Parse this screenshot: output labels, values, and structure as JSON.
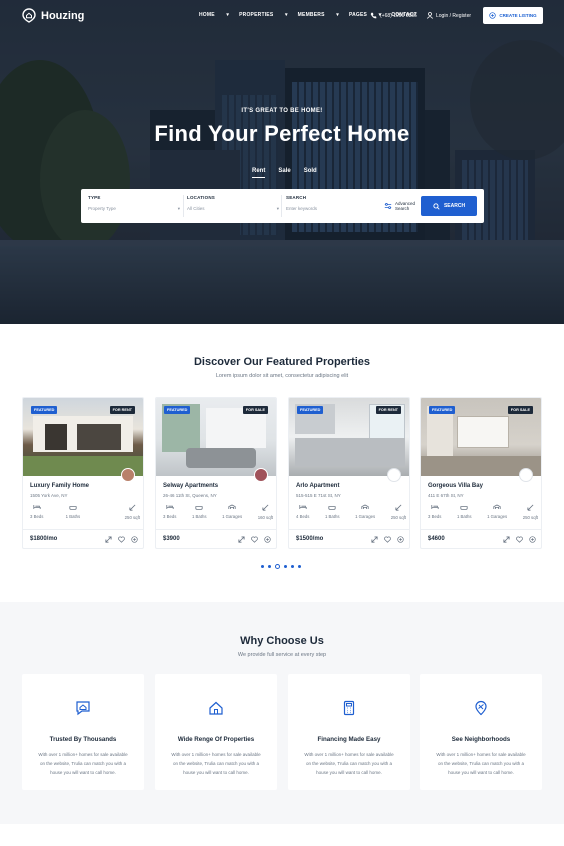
{
  "brand": {
    "name": "Houzing",
    "accent": "#1f5fd0",
    "dark": "#1d2a3a"
  },
  "nav": {
    "items": [
      "HOME",
      "PROPERTIES",
      "MEMBERS",
      "PAGES",
      "CONTACT"
    ],
    "phone": "(+68) 1990 6886",
    "login": "Login / Register",
    "cta": "CREATE LISTING"
  },
  "hero": {
    "kicker": "IT'S GREAT TO BE HOME!",
    "title": "Find Your Perfect Home",
    "tabs": [
      "Rent",
      "Sale",
      "Sold"
    ],
    "active_tab": "Rent"
  },
  "search": {
    "type": {
      "label": "TYPE",
      "value": "Property Type"
    },
    "location": {
      "label": "LOCATIONS",
      "value": "All Cities"
    },
    "keyword": {
      "label": "SEARCH",
      "placeholder": "Enter keywords"
    },
    "advanced_line1": "Advanced",
    "advanced_line2": "Search",
    "button": "SEARCH"
  },
  "featured": {
    "title": "Discover Our Featured Properties",
    "subtitle": "Lorem ipsum dolor sit amet, consectetur adipiscing elit",
    "cards": [
      {
        "badge": "FEATURED",
        "status": "FOR RENT",
        "name": "Luxury Family Home",
        "address": "1505 York Ave, NY",
        "f1": "3 Beds",
        "f2": "1 Baths",
        "f3": "",
        "f4": "250 sqft",
        "price": "$1800/mo"
      },
      {
        "badge": "FEATURED",
        "status": "FOR SALE",
        "name": "Selway Apartments",
        "address": "26-46 11th St, Queens, NY",
        "f1": "3 Beds",
        "f2": "1 Baths",
        "f3": "1 Garages",
        "f4": "160 sqft",
        "price": "$3900"
      },
      {
        "badge": "FEATURED",
        "status": "FOR RENT",
        "name": "Arlo Apartment",
        "address": "515-515 E 71st St, NY",
        "f1": "4 Beds",
        "f2": "1 Baths",
        "f3": "1 Garages",
        "f4": "250 sqft",
        "price": "$1500/mo"
      },
      {
        "badge": "FEATURED",
        "status": "FOR SALE",
        "name": "Gorgeous Villa Bay",
        "address": "411 E 67th St, NY",
        "f1": "3 Beds",
        "f2": "1 Baths",
        "f3": "1 Garages",
        "f4": "250 sqft",
        "price": "$4600"
      }
    ],
    "pager": {
      "pages": 6,
      "current": 3
    }
  },
  "why": {
    "title": "Why Choose Us",
    "subtitle": "We provide full service at every step",
    "cards": [
      {
        "icon": "chat-house-icon",
        "title": "Trusted By Thousands",
        "line1": "With over 1 million+ homes for sale available",
        "line2": "on the website, Trulia can match you with a",
        "line3": "house you will want to call home."
      },
      {
        "icon": "house-icon",
        "title": "Wide Renge Of Properties",
        "line1": "With over 1 million+ homes for sale available",
        "line2": "on the website, Trulia can match you with a",
        "line3": "house you will want to call home."
      },
      {
        "icon": "calculator-icon",
        "title": "Financing Made Easy",
        "line1": "With over 1 million+ homes for sale available",
        "line2": "on the website, Trulia can match you with a",
        "line3": "house you will want to call home."
      },
      {
        "icon": "map-pin-icon",
        "title": "See Neighborhoods",
        "line1": "With over 1 million+ homes for sale available",
        "line2": "on the website, Trulia can match you with a",
        "line3": "house you will want to call home."
      }
    ]
  }
}
